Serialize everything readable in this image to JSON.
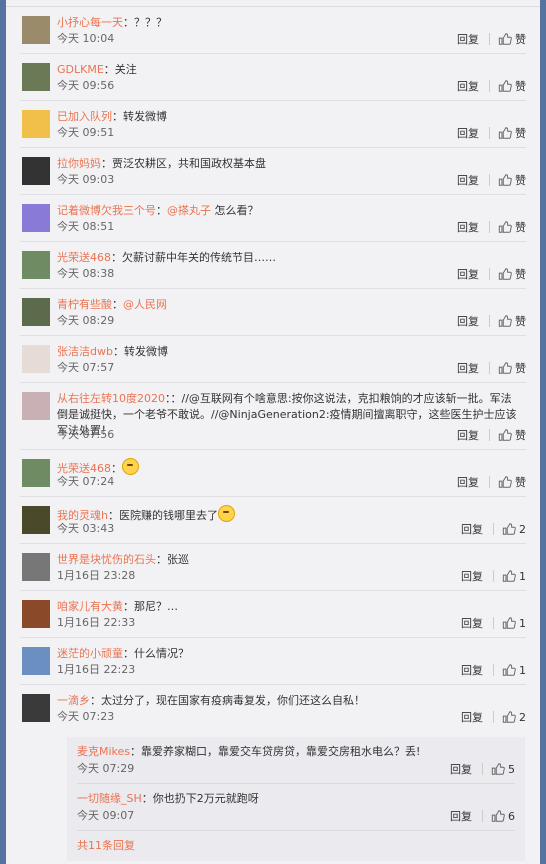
{
  "labels": {
    "reply": "回复",
    "like": "赞"
  },
  "comments": [
    {
      "nick": "小抒心每一天",
      "text": "？？？",
      "time": "今天 10:04",
      "likes": "赞",
      "avatar": "#9a8c6a"
    },
    {
      "nick": "GDLKME",
      "text": "关注",
      "time": "今天 09:56",
      "likes": "赞",
      "avatar": "#6a7a56"
    },
    {
      "nick": "已加入队列",
      "text": "转发微博",
      "time": "今天 09:51",
      "likes": "赞",
      "avatar": "#f1c04a"
    },
    {
      "nick": "拉你妈妈",
      "text": "贾泛农耕区，共和国政权基本盘",
      "time": "今天 09:03",
      "likes": "赞",
      "avatar": "#333333"
    },
    {
      "nick": "记着微博欠我三个号",
      "mention": "@搽丸子",
      "text": " 怎么看？",
      "time": "今天 08:51",
      "likes": "赞",
      "avatar": "#8a7ad8"
    },
    {
      "nick": "光荣送468",
      "text": "欠薪讨薪中年关的传统节目……",
      "time": "今天 08:38",
      "likes": "赞",
      "avatar": "#6f8b63"
    },
    {
      "nick": "青柠有些酸",
      "mention": "@人民网",
      "text": "",
      "time": "今天 08:29",
      "likes": "赞",
      "avatar": "#5c6b4c"
    },
    {
      "nick": "张洁洁dwb",
      "text": "转发微博",
      "time": "今天 07:57",
      "likes": "赞",
      "avatar": "#e6dbd5"
    },
    {
      "nick": "从右往左转10度2020",
      "text": "：//@互联网有个啥意思:按你这说法，克扣粮饷的才应该斩一批。军法倒是诚挺快，一个老爷不敢说。//@NinjaGeneration2:疫情期间擅离职守，这些医生护士应该军法处置！",
      "time": "今天 07:56",
      "likes": "赞",
      "avatar": "#c9b0b5",
      "tall": true
    },
    {
      "nick": "光荣送468",
      "emoji": true,
      "text": "",
      "time": "今天 07:24",
      "likes": "赞",
      "avatar": "#6f8b63"
    },
    {
      "nick": "我的灵魂h",
      "text": "医院赚的钱哪里去了",
      "emoji_after": true,
      "time": "今天 03:43",
      "likes": "2",
      "avatar": "#4a4a2a"
    },
    {
      "nick": "世界是块忧伤的石头",
      "text": "张巡",
      "time": "1月16日 23:28",
      "likes": "1",
      "avatar": "#777"
    },
    {
      "nick": "咱家儿有大黄",
      "text": "那尼？…",
      "time": "1月16日 22:33",
      "likes": "1",
      "avatar": "#8a4a2a"
    },
    {
      "nick": "迷茫的小顽童",
      "text": "什么情况？",
      "time": "1月16日 22:23",
      "likes": "1",
      "avatar": "#6a8fc0"
    },
    {
      "nick": "一滴乡",
      "text": "太过分了，现在国家有疫病毒复发，你们还这么自私！",
      "time": "今天 07:23",
      "likes": "2",
      "avatar": "#3a3a3a",
      "parent": true
    }
  ],
  "subreplies": [
    {
      "nick": "麦克Mikes",
      "text": "靠爱养家糊口，靠爱交车贷房贷，靠爱交房租水电么？丢!",
      "time": "今天 07:29",
      "likes": "5"
    },
    {
      "nick": "一切随缘_SH",
      "text": "你也扔下2万元就跑呀",
      "time": "今天 09:07",
      "likes": "6"
    }
  ],
  "more_replies": "共11条回复"
}
